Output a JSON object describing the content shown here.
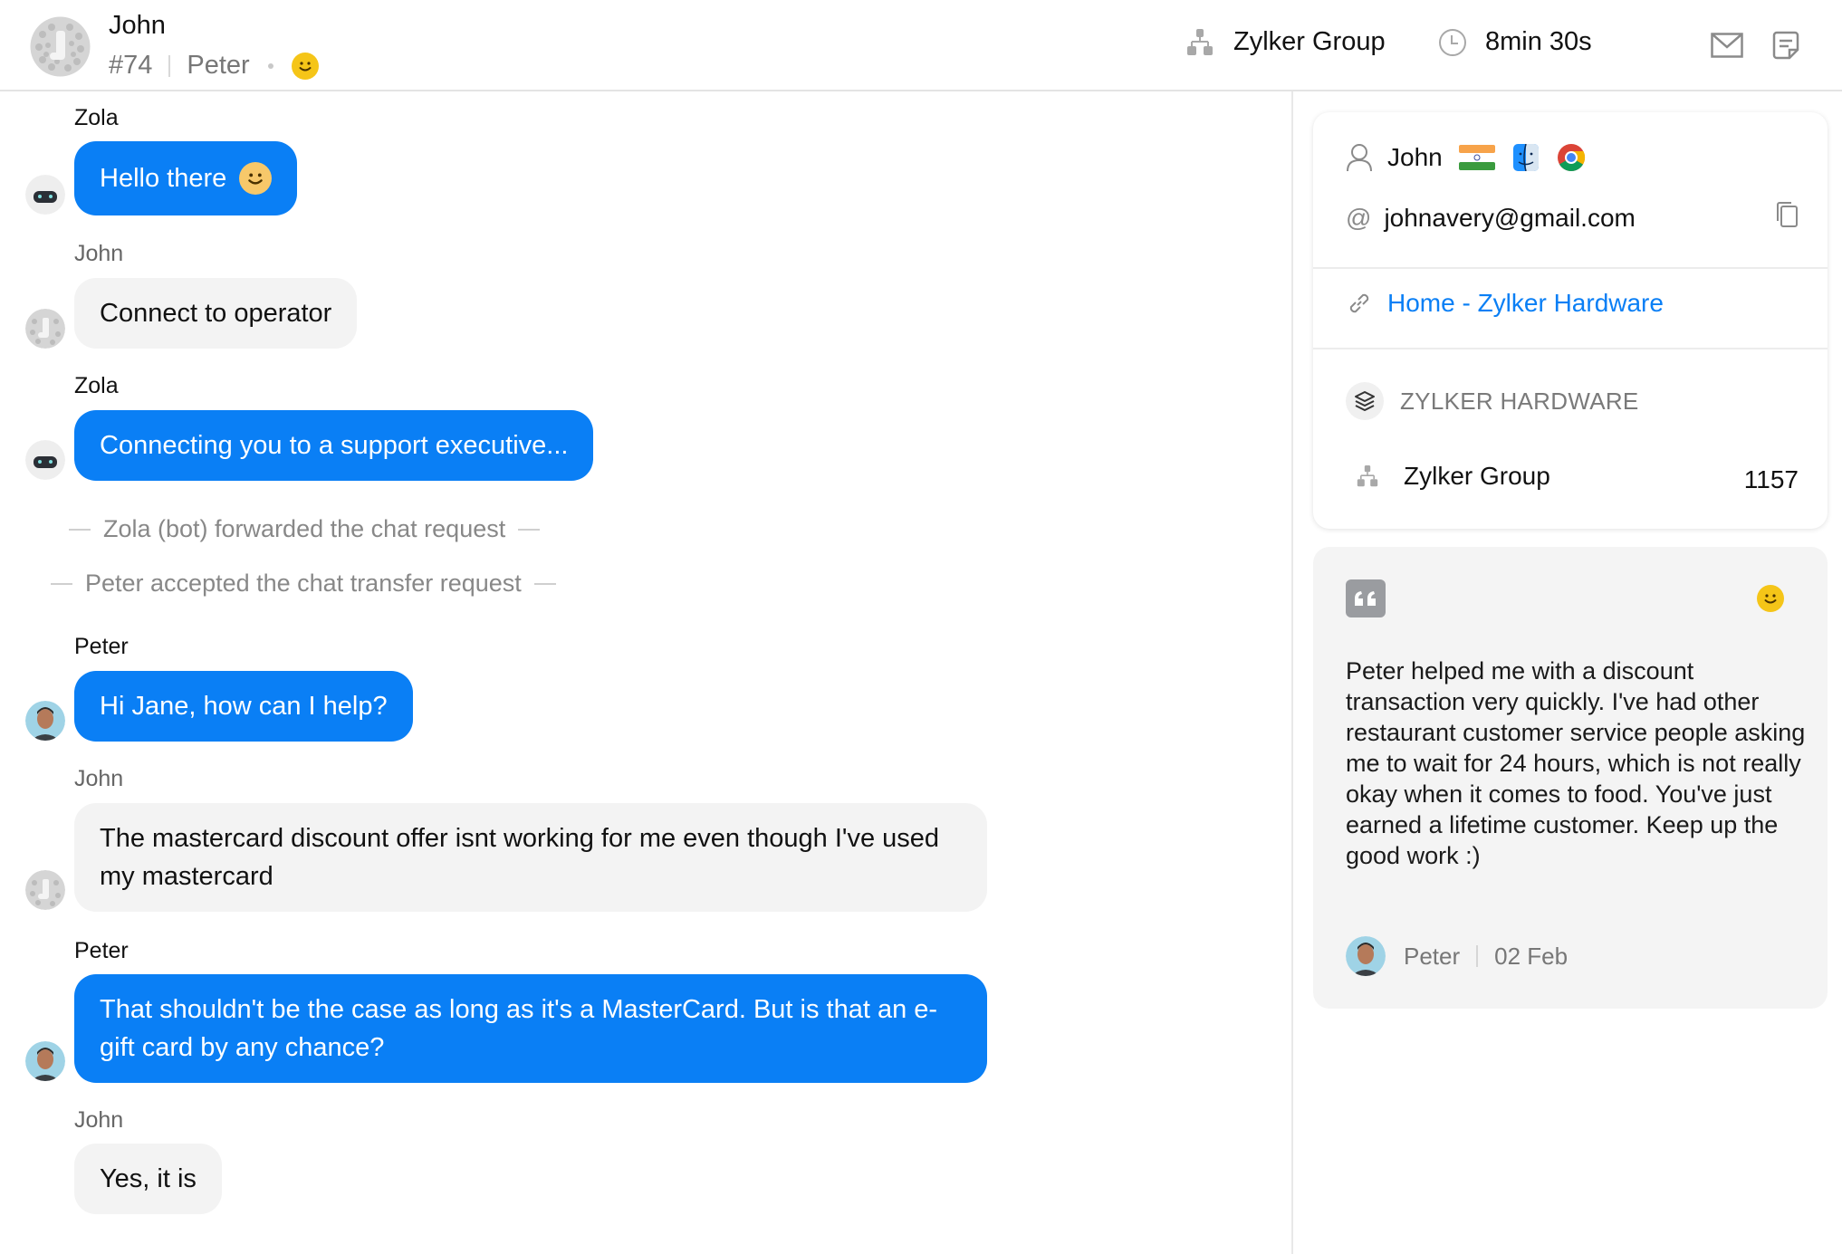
{
  "header": {
    "visitor_name": "John",
    "chat_id": "#74",
    "operator": "Peter",
    "rating_icon": "smiley-icon",
    "department": "Zylker Group",
    "department_icon": "org-chart-icon",
    "duration": "8min 30s",
    "duration_icon": "clock-icon",
    "actions": [
      {
        "name": "email-transcript",
        "icon": "mail-icon"
      },
      {
        "name": "notes",
        "icon": "note-icon"
      }
    ]
  },
  "chat": {
    "messages": [
      {
        "sender": "Zola",
        "role": "bot",
        "text": "Hello there",
        "has_emoji": true,
        "style": "blue"
      },
      {
        "sender": "John",
        "role": "visitor",
        "text": "Connect to operator",
        "style": "grey"
      },
      {
        "sender": "Zola",
        "role": "bot",
        "text": "Connecting you to a support executive...",
        "style": "blue"
      },
      {
        "sender": "Peter",
        "role": "operator",
        "text": "Hi Jane, how can I help?",
        "style": "blue"
      },
      {
        "sender": "John",
        "role": "visitor",
        "text": "The mastercard discount offer isnt working for me even though I've used my mastercard",
        "style": "grey"
      },
      {
        "sender": "Peter",
        "role": "operator",
        "text": "That shouldn't be the case as long as it's a MasterCard. But is that an e-gift card by any chance?",
        "style": "blue"
      },
      {
        "sender": "John",
        "role": "visitor",
        "text": "Yes, it is",
        "style": "grey"
      }
    ],
    "system_events": [
      "Zola (bot) forwarded the chat request",
      "Peter accepted the chat transfer request"
    ]
  },
  "visitor_info": {
    "name": "John",
    "country_icon": "india-flag-icon",
    "os_icon": "macos-finder-icon",
    "browser_icon": "chrome-icon",
    "email": "johnavery@gmail.com",
    "copy_icon": "copy-icon",
    "page_link": "Home - Zylker Hardware",
    "brand": "ZYLKER HARDWARE",
    "department": "Zylker Group",
    "department_count": "1157"
  },
  "feedback": {
    "quote_icon": "quote-icon",
    "rating_icon": "smiley-icon",
    "text": "Peter helped me with a discount transaction very quickly. I've had other restaurant customer service people asking me to wait for 24 hours, which is not really okay when it comes to food. You've just earned a lifetime customer. Keep up the good work :)",
    "author": "Peter",
    "date": "02 Feb"
  },
  "colors": {
    "accent": "#0a7ff5",
    "visitor_bubble": "#f3f3f3",
    "smiley": "#f5c518"
  }
}
